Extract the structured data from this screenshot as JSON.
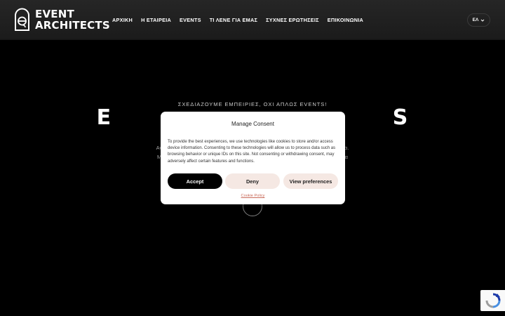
{
  "header": {
    "logo": {
      "line1": "EVENT",
      "line2": "ARCHITECTS",
      "icon": "event-architects-logo-mark"
    },
    "nav": [
      {
        "label": "ΑΡΧΙΚΗ"
      },
      {
        "label": "Η ΕΤΑΙΡΕΙΑ"
      },
      {
        "label": "EVENTS"
      },
      {
        "label": "ΤΙ ΛΕΝΕ ΓΙΑ ΕΜΑΣ"
      },
      {
        "label": "ΣΥΧΝΕΣ ΕΡΩΤΗΣΕΙΣ"
      },
      {
        "label": "ΕΠΙΚΟΙΝΩΝΙΑ"
      }
    ],
    "language": {
      "label": "ΕΛ",
      "icon": "chevron-down-icon"
    }
  },
  "hero": {
    "tagline": "ΣΧΕΔΙΑΖΟΥΜΕ ΕΜΠΕΙΡΙΕΣ, ΟΧΙ ΑΠΛΩΣ EVENTS!",
    "title": "E                                   S",
    "text_line1": "Αν                                                                                                                          κία.",
    "text_line2": "Με                                                                                                                          να"
  },
  "consent": {
    "title": "Manage Consent",
    "body": "To provide the best experiences, we use technologies like cookies to store and/or access device information. Consenting to these technologies will allow us to process data such as browsing behavior or unique IDs on this site. Not consenting or withdrawing consent, may adversely affect certain features and functions.",
    "accept_label": "Accept",
    "deny_label": "Deny",
    "preferences_label": "View preferences",
    "policy_link": "Cookie Policy"
  },
  "colors": {
    "background": "#000000",
    "header": "#222222",
    "accept_button": "#000000",
    "secondary_button": "#f5e8e3",
    "policy_link": "#c96b5a",
    "recaptcha_blue": "#1c3aa9"
  },
  "widgets": {
    "recaptcha_icon": "recaptcha-icon"
  }
}
